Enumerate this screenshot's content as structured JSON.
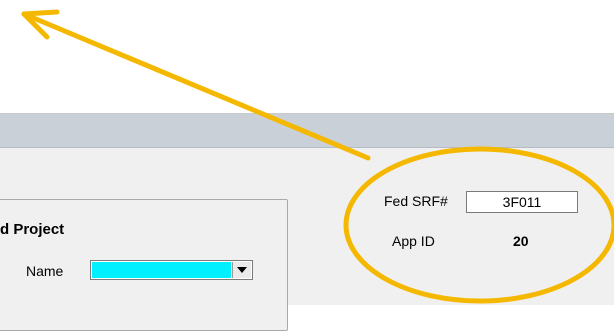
{
  "colors": {
    "annotation": "#f5b800",
    "titlebar": "#c9d0d8",
    "name_highlight": "#00f0ff"
  },
  "group": {
    "title": "d Project",
    "name_label": "Name",
    "name_value": ""
  },
  "fed_srf": {
    "label": "Fed SRF#",
    "value": "3F011"
  },
  "app_id": {
    "label": "App ID",
    "value": "20"
  },
  "icons": {
    "dropdown": "chevron-down-icon"
  }
}
